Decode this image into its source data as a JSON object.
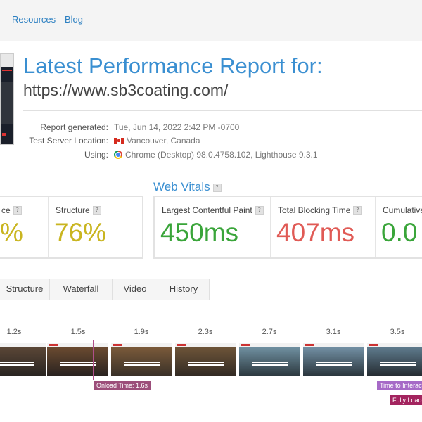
{
  "nav": {
    "resources": "Resources",
    "blog": "Blog"
  },
  "report": {
    "title": "Latest Performance Report for:",
    "url": "https://www.sb3coating.com/",
    "meta": [
      {
        "label": "Report generated:",
        "value": "Tue, Jun 14, 2022 2:42 PM -0700"
      },
      {
        "label": "Test Server Location:",
        "value": "Vancouver, Canada"
      },
      {
        "label": "Using:",
        "value": "Chrome (Desktop) 98.0.4758.102, Lighthouse 9.3.1"
      }
    ]
  },
  "grade": {
    "performance_label": "ce",
    "performance_value": "%",
    "structure_label": "Structure",
    "structure_value": "76%"
  },
  "web_vitals": {
    "title": "Web Vitals",
    "lcp_label": "Largest Contentful Paint",
    "lcp_value": "450ms",
    "tbt_label": "Total Blocking Time",
    "tbt_value": "407ms",
    "cls_label": "Cumulative",
    "cls_value": "0.0"
  },
  "help_glyph": "?",
  "tabs": [
    "Structure",
    "Waterfall",
    "Video",
    "History"
  ],
  "filmstrip": {
    "times": [
      "1.2s",
      "1.5s",
      "1.9s",
      "2.3s",
      "2.7s",
      "3.1s",
      "3.5s"
    ],
    "onload": "Onload Time: 1.6s",
    "tti": "Time to Interactive",
    "fully_loaded": "Fully Loaded"
  },
  "colors": {
    "accent": "#3a8fd1",
    "grade_yellow": "#c9b520",
    "good_green": "#3aa53a",
    "bad_red": "#e05a55",
    "onload": "#9c4e7a"
  }
}
